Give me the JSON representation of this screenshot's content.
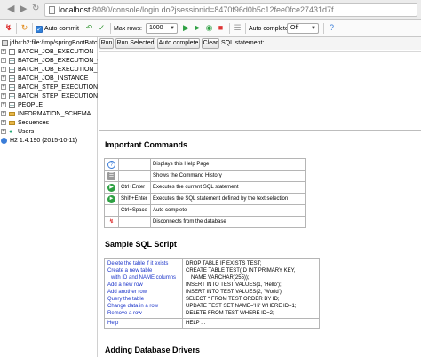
{
  "browser": {
    "url_host": "localhost",
    "url_path": ":8080/console/login.do?jsessionid=8470f96d0b5c12fee0fce27431d7f"
  },
  "toolbar": {
    "auto_commit_label": "Auto commit",
    "max_rows_label": "Max rows:",
    "max_rows_value": "1000",
    "auto_complete_label": "Auto complete",
    "auto_complete_value": "Off"
  },
  "tree": {
    "connection": "jdbc:h2:file:/tmp/springBootBatch",
    "items": [
      "BATCH_JOB_EXECUTION",
      "BATCH_JOB_EXECUTION_C",
      "BATCH_JOB_EXECUTION_P",
      "BATCH_JOB_INSTANCE",
      "BATCH_STEP_EXECUTION",
      "BATCH_STEP_EXECUTION_",
      "PEOPLE",
      "INFORMATION_SCHEMA",
      "Sequences",
      "Users"
    ],
    "version": "H2 1.4.190 (2015-10-11)"
  },
  "sql_bar": {
    "run": "Run",
    "run_selected": "Run Selected",
    "auto_complete": "Auto complete",
    "clear": "Clear",
    "statement_label": "SQL statement:"
  },
  "help": {
    "important_title": "Important Commands",
    "commands": [
      {
        "icon": "help-icon",
        "key": "",
        "desc": "Displays this Help Page"
      },
      {
        "icon": "history-icon",
        "key": "",
        "desc": "Shows the Command History"
      },
      {
        "icon": "run-icon",
        "key": "Ctrl+Enter",
        "desc": "Executes the current SQL statement"
      },
      {
        "icon": "run-selected-icon",
        "key": "Shift+Enter",
        "desc": "Executes the SQL statement defined by the text selection"
      },
      {
        "icon": "",
        "key": "Ctrl+Space",
        "desc": "Auto complete"
      },
      {
        "icon": "disconnect-icon",
        "key": "",
        "desc": "Disconnects from the database"
      }
    ],
    "sample_title": "Sample SQL Script",
    "sample_links": [
      "Delete the table if it exists",
      "Create a new table",
      "with ID and NAME columns",
      "Add a new row",
      "Add another row",
      "Query the table",
      "Change data in a row",
      "Remove a row"
    ],
    "sample_code": [
      "DROP TABLE IF EXISTS TEST;",
      "CREATE TABLE TEST(ID INT PRIMARY KEY,",
      "NAME VARCHAR(255));",
      "INSERT INTO TEST VALUES(1, 'Hello');",
      "INSERT INTO TEST VALUES(2, 'World');",
      "SELECT * FROM TEST ORDER BY ID;",
      "UPDATE TEST SET NAME='Hi' WHERE ID=1;",
      "DELETE FROM TEST WHERE ID=2;"
    ],
    "help_link": "Help",
    "help_code": "HELP ...",
    "drivers_title": "Adding Database Drivers"
  },
  "colors": {
    "link": "#1a33c9",
    "accent_blue": "#2f7fd8",
    "run_green": "#2ea043",
    "disconnect_red": "#d33"
  }
}
